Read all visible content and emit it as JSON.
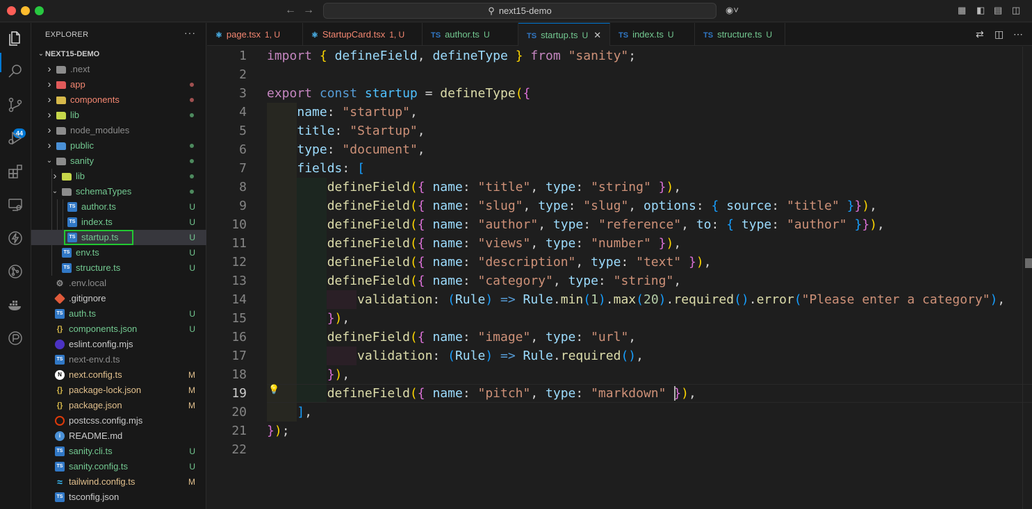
{
  "titlebar": {
    "search_text": "next15-demo",
    "back_icon": "arrow-left-icon",
    "forward_icon": "arrow-right-icon",
    "copilot_icon": "copilot-icon"
  },
  "activitybar": {
    "items": [
      "explorer-icon",
      "search-icon",
      "source-control-icon",
      "run-debug-icon",
      "extensions-icon",
      "remote-explorer-icon",
      "thunder-client-icon",
      "git-graph-icon",
      "docker-icon",
      "testing-icon"
    ],
    "badge": "44"
  },
  "sidebar": {
    "title": "EXPLORER",
    "more": "···",
    "root": "NEXT15-DEMO",
    "items": [
      {
        "label": ".next",
        "color": "#8c8c8c",
        "status": "",
        "dot": ""
      },
      {
        "label": "app",
        "color": "#f48771",
        "status": "",
        "dot": "#a05050"
      },
      {
        "label": "components",
        "color": "#f48771",
        "status": "",
        "dot": "#a05050"
      },
      {
        "label": "lib",
        "color": "#73c991",
        "status": "",
        "dot": "#4d8a5e"
      },
      {
        "label": "node_modules",
        "color": "#8c8c8c",
        "status": "",
        "dot": ""
      },
      {
        "label": "public",
        "color": "#73c991",
        "status": "",
        "dot": "#4d8a5e"
      },
      {
        "label": "sanity",
        "color": "#73c991",
        "status": "",
        "dot": "#4d8a5e"
      },
      {
        "label": "lib",
        "color": "#73c991",
        "status": "",
        "dot": "#4d8a5e"
      },
      {
        "label": "schemaTypes",
        "color": "#73c991",
        "status": "",
        "dot": "#4d8a5e"
      },
      {
        "label": "author.ts",
        "color": "#73c991",
        "status": "U",
        "dot": ""
      },
      {
        "label": "index.ts",
        "color": "#73c991",
        "status": "U",
        "dot": ""
      },
      {
        "label": "startup.ts",
        "color": "#73c991",
        "status": "U",
        "dot": ""
      },
      {
        "label": "env.ts",
        "color": "#73c991",
        "status": "U",
        "dot": ""
      },
      {
        "label": "structure.ts",
        "color": "#73c991",
        "status": "U",
        "dot": ""
      },
      {
        "label": ".env.local",
        "color": "#8c8c8c",
        "status": "",
        "dot": ""
      },
      {
        "label": ".gitignore",
        "color": "#cccccc",
        "status": "",
        "dot": ""
      },
      {
        "label": "auth.ts",
        "color": "#73c991",
        "status": "U",
        "dot": ""
      },
      {
        "label": "components.json",
        "color": "#73c991",
        "status": "U",
        "dot": ""
      },
      {
        "label": "eslint.config.mjs",
        "color": "#cccccc",
        "status": "",
        "dot": ""
      },
      {
        "label": "next-env.d.ts",
        "color": "#8c8c8c",
        "status": "",
        "dot": ""
      },
      {
        "label": "next.config.ts",
        "color": "#e2c08d",
        "status": "M",
        "dot": ""
      },
      {
        "label": "package-lock.json",
        "color": "#e2c08d",
        "status": "M",
        "dot": ""
      },
      {
        "label": "package.json",
        "color": "#e2c08d",
        "status": "M",
        "dot": ""
      },
      {
        "label": "postcss.config.mjs",
        "color": "#cccccc",
        "status": "",
        "dot": ""
      },
      {
        "label": "README.md",
        "color": "#cccccc",
        "status": "",
        "dot": ""
      },
      {
        "label": "sanity.cli.ts",
        "color": "#73c991",
        "status": "U",
        "dot": ""
      },
      {
        "label": "sanity.config.ts",
        "color": "#73c991",
        "status": "U",
        "dot": ""
      },
      {
        "label": "tailwind.config.ts",
        "color": "#e2c08d",
        "status": "M",
        "dot": ""
      },
      {
        "label": "tsconfig.json",
        "color": "#cccccc",
        "status": "",
        "dot": ""
      }
    ]
  },
  "tabs": [
    {
      "label": "page.tsx",
      "status": "1, U",
      "color": "#f48771",
      "icon": "react-icon"
    },
    {
      "label": "StartupCard.tsx",
      "status": "1, U",
      "color": "#f48771",
      "icon": "react-icon"
    },
    {
      "label": "author.ts",
      "status": "U",
      "color": "#73c991",
      "icon": "ts-file-icon"
    },
    {
      "label": "startup.ts",
      "status": "U",
      "color": "#73c991",
      "icon": "ts-file-icon"
    },
    {
      "label": "index.ts",
      "status": "U",
      "color": "#73c991",
      "icon": "ts-file-icon"
    },
    {
      "label": "structure.ts",
      "status": "U",
      "color": "#73c991",
      "icon": "ts-file-icon"
    }
  ],
  "editor": {
    "line_numbers": [
      "1",
      "2",
      "3",
      "4",
      "5",
      "6",
      "7",
      "8",
      "9",
      "10",
      "11",
      "12",
      "13",
      "14",
      "15",
      "16",
      "17",
      "18",
      "19",
      "20",
      "21",
      "22"
    ],
    "current_line": "19"
  }
}
